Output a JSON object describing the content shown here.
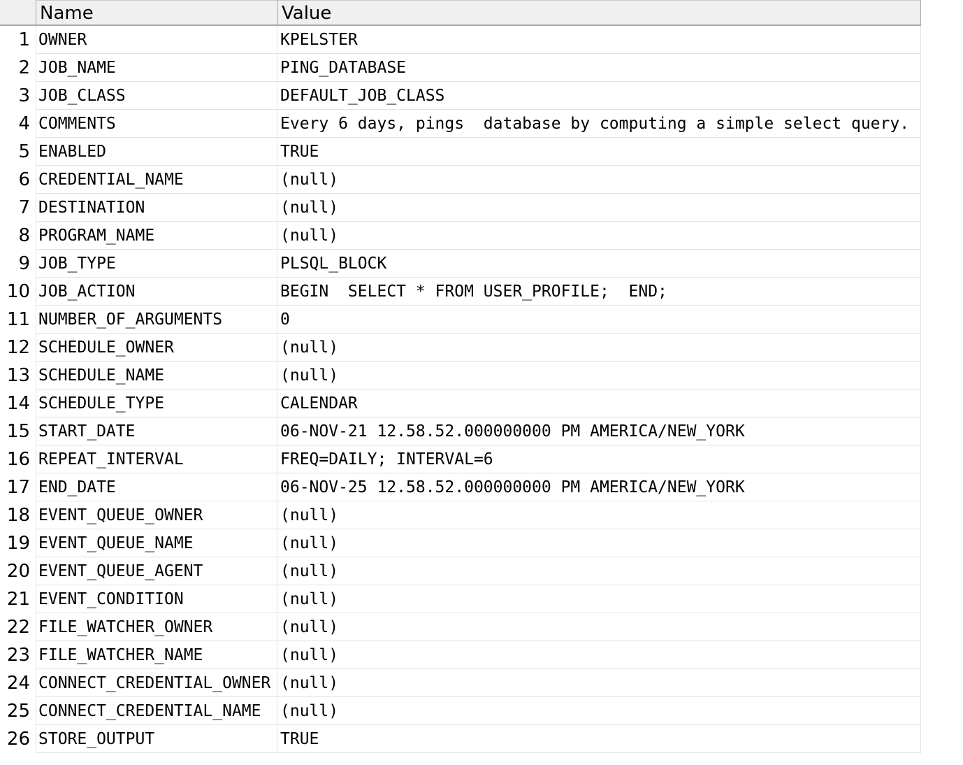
{
  "table": {
    "columns": [
      "Name",
      "Value"
    ],
    "rows": [
      {
        "num": "1",
        "name": "OWNER",
        "value": "KPELSTER"
      },
      {
        "num": "2",
        "name": "JOB_NAME",
        "value": "PING_DATABASE"
      },
      {
        "num": "3",
        "name": "JOB_CLASS",
        "value": "DEFAULT_JOB_CLASS"
      },
      {
        "num": "4",
        "name": "COMMENTS",
        "value": "Every 6 days, pings  database by computing a simple select query."
      },
      {
        "num": "5",
        "name": "ENABLED",
        "value": "TRUE"
      },
      {
        "num": "6",
        "name": "CREDENTIAL_NAME",
        "value": "(null)"
      },
      {
        "num": "7",
        "name": "DESTINATION",
        "value": "(null)"
      },
      {
        "num": "8",
        "name": "PROGRAM_NAME",
        "value": "(null)"
      },
      {
        "num": "9",
        "name": "JOB_TYPE",
        "value": "PLSQL_BLOCK"
      },
      {
        "num": "10",
        "name": "JOB_ACTION",
        "value": "BEGIN  SELECT * FROM USER_PROFILE;  END;"
      },
      {
        "num": "11",
        "name": "NUMBER_OF_ARGUMENTS",
        "value": "0"
      },
      {
        "num": "12",
        "name": "SCHEDULE_OWNER",
        "value": "(null)"
      },
      {
        "num": "13",
        "name": "SCHEDULE_NAME",
        "value": "(null)"
      },
      {
        "num": "14",
        "name": "SCHEDULE_TYPE",
        "value": "CALENDAR"
      },
      {
        "num": "15",
        "name": "START_DATE",
        "value": "06-NOV-21 12.58.52.000000000 PM AMERICA/NEW_YORK"
      },
      {
        "num": "16",
        "name": "REPEAT_INTERVAL",
        "value": "FREQ=DAILY; INTERVAL=6"
      },
      {
        "num": "17",
        "name": "END_DATE",
        "value": "06-NOV-25 12.58.52.000000000 PM AMERICA/NEW_YORK"
      },
      {
        "num": "18",
        "name": "EVENT_QUEUE_OWNER",
        "value": "(null)"
      },
      {
        "num": "19",
        "name": "EVENT_QUEUE_NAME",
        "value": "(null)"
      },
      {
        "num": "20",
        "name": "EVENT_QUEUE_AGENT",
        "value": "(null)"
      },
      {
        "num": "21",
        "name": "EVENT_CONDITION",
        "value": "(null)"
      },
      {
        "num": "22",
        "name": "FILE_WATCHER_OWNER",
        "value": "(null)"
      },
      {
        "num": "23",
        "name": "FILE_WATCHER_NAME",
        "value": "(null)"
      },
      {
        "num": "24",
        "name": "CONNECT_CREDENTIAL_OWNER",
        "value": "(null)"
      },
      {
        "num": "25",
        "name": "CONNECT_CREDENTIAL_NAME",
        "value": "(null)"
      },
      {
        "num": "26",
        "name": "STORE_OUTPUT",
        "value": "TRUE"
      }
    ]
  }
}
